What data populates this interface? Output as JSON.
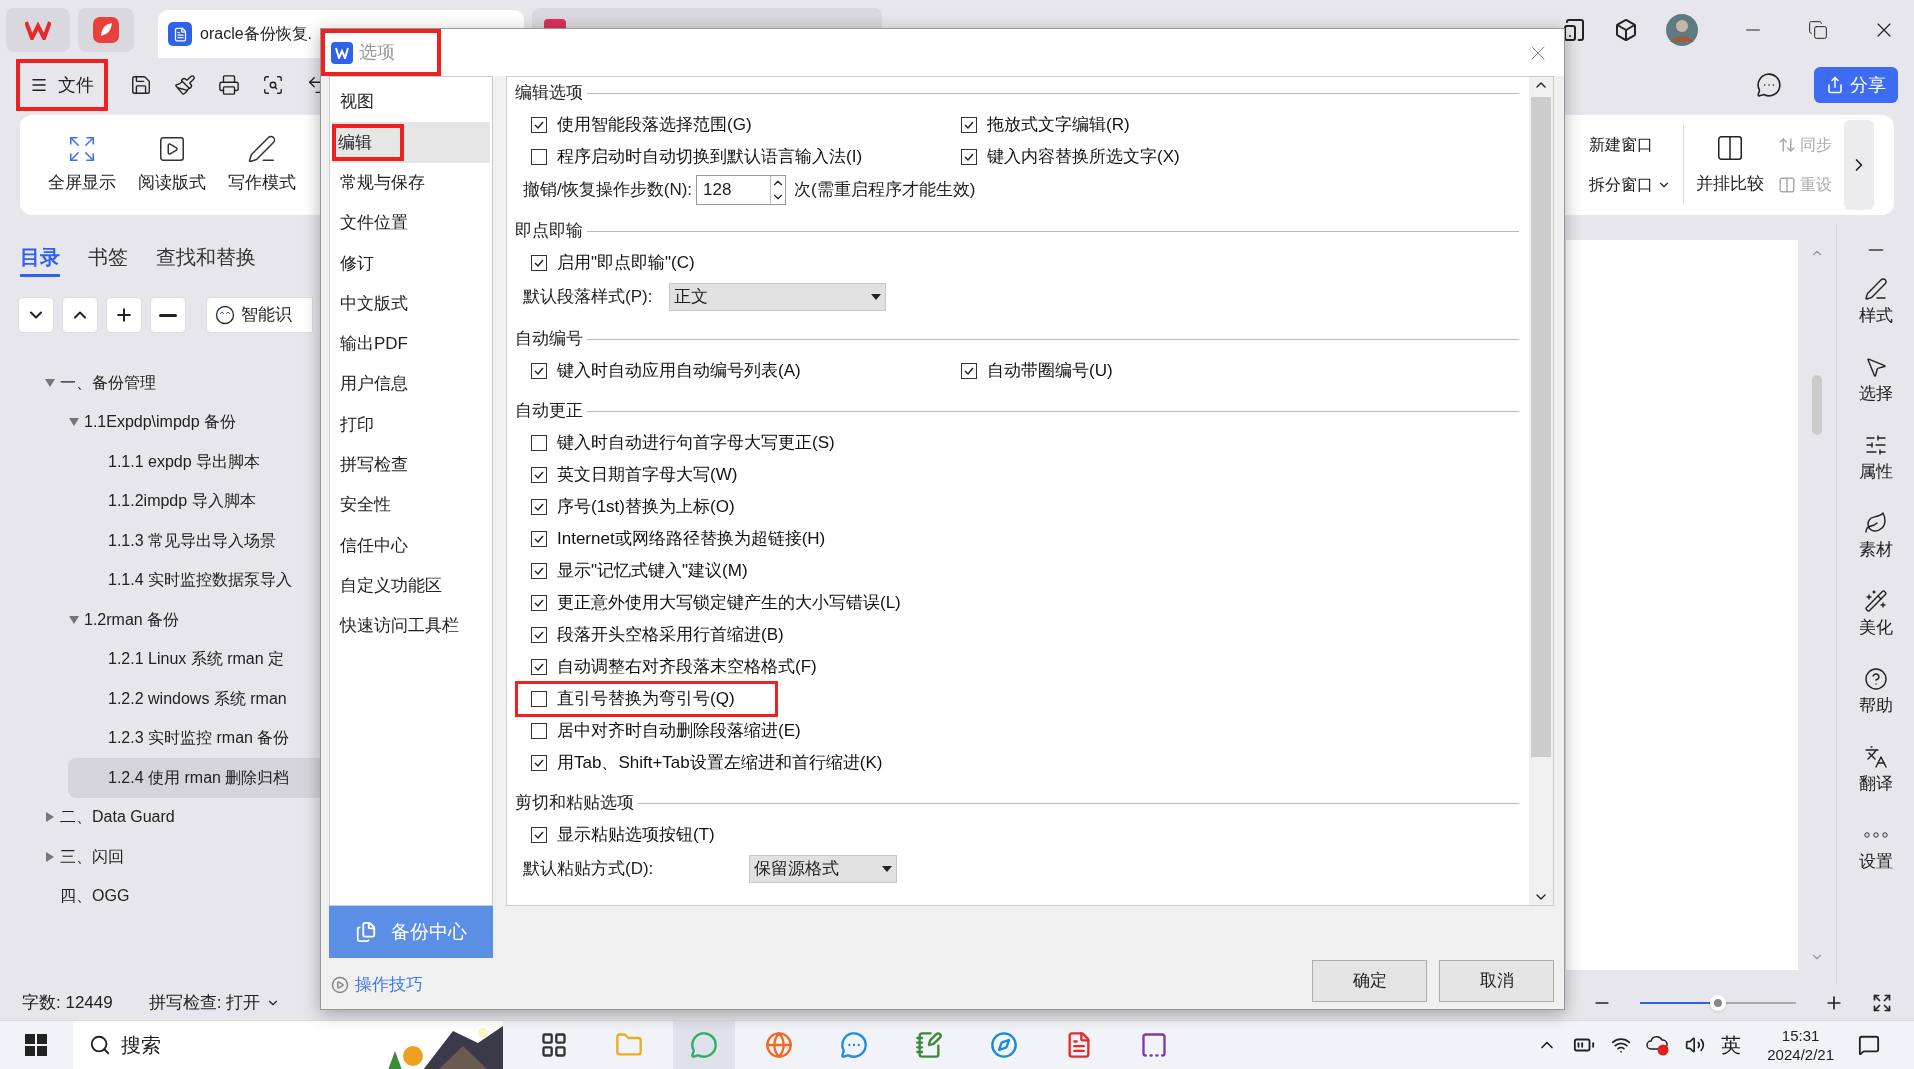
{
  "doc_tab": {
    "title": "oracle备份恢复."
  },
  "toolbar": {
    "file_button": {
      "label": "文件",
      "annotated": true
    },
    "share": "分享"
  },
  "ribbon": {
    "left": [
      "全屏显示",
      "阅读版式",
      "写作模式"
    ],
    "window_items": [
      "新建窗口",
      "拆分窗口"
    ],
    "compare": "并排比较",
    "sync_items": [
      {
        "label": "同步",
        "disabled": true
      },
      {
        "label": "重设",
        "disabled": true
      }
    ]
  },
  "nav_panel": {
    "tabs": [
      {
        "label": "目录",
        "selected": true
      },
      {
        "label": "书签",
        "selected": false
      },
      {
        "label": "查找和替换",
        "selected": false
      }
    ],
    "smart_button": "智能识",
    "tree": [
      {
        "label": "一、备份管理",
        "expanded": true,
        "selected": false,
        "children": [
          {
            "label": "1.1Expdp\\impdp 备份",
            "expanded": true,
            "selected": false,
            "children": [
              {
                "label": "1.1.1 expdp 导出脚本",
                "selected": false
              },
              {
                "label": "1.1.2impdp 导入脚本",
                "selected": false
              },
              {
                "label": "1.1.3 常见导出导入场景",
                "selected": false
              },
              {
                "label": "1.1.4 实时监控数据泵导入",
                "selected": false
              }
            ]
          },
          {
            "label": "1.2rman 备份",
            "expanded": true,
            "selected": false,
            "children": [
              {
                "label": "1.2.1 Linux 系统 rman 定",
                "selected": false
              },
              {
                "label": "1.2.2 windows 系统 rman",
                "selected": false
              },
              {
                "label": "1.2.3 实时监控 rman 备份",
                "selected": false
              },
              {
                "label": "1.2.4  使用 rman 删除归档",
                "selected": true
              }
            ]
          }
        ]
      },
      {
        "label": "二、Data Guard",
        "expanded": false,
        "selected": false
      },
      {
        "label": "三、闪回",
        "expanded": false,
        "selected": false
      },
      {
        "label": "四、OGG",
        "selected": false
      }
    ]
  },
  "dialog": {
    "title": "选项",
    "title_annotated": true,
    "nav": [
      {
        "label": "视图",
        "selected": false,
        "annotated": false
      },
      {
        "label": "编辑",
        "selected": true,
        "annotated": true
      },
      {
        "label": "常规与保存",
        "selected": false,
        "annotated": false
      },
      {
        "label": "文件位置",
        "selected": false,
        "annotated": false
      },
      {
        "label": "修订",
        "selected": false,
        "annotated": false
      },
      {
        "label": "中文版式",
        "selected": false,
        "annotated": false
      },
      {
        "label": "输出PDF",
        "selected": false,
        "annotated": false
      },
      {
        "label": "用户信息",
        "selected": false,
        "annotated": false
      },
      {
        "label": "打印",
        "selected": false,
        "annotated": false
      },
      {
        "label": "拼写检查",
        "selected": false,
        "annotated": false
      },
      {
        "label": "安全性",
        "selected": false,
        "annotated": false
      },
      {
        "label": "信任中心",
        "selected": false,
        "annotated": false
      },
      {
        "label": "自定义功能区",
        "selected": false,
        "annotated": false
      },
      {
        "label": "快速访问工具栏",
        "selected": false,
        "annotated": false
      }
    ],
    "backup_button": "备份中心",
    "tips_link": "操作技巧",
    "sections": [
      {
        "title": "编辑选项",
        "rows": [
          {
            "kind": "pair",
            "items": [
              {
                "label": "使用智能段落选择范围(G)",
                "checked": true,
                "annotated": false
              },
              {
                "label": "拖放式文字编辑(R)",
                "checked": true,
                "annotated": false
              }
            ]
          },
          {
            "kind": "pair",
            "items": [
              {
                "label": "程序启动时自动切换到默认语言输入法(I)",
                "checked": false,
                "annotated": false
              },
              {
                "label": "键入内容替换所选文字(X)",
                "checked": true,
                "annotated": false
              }
            ]
          },
          {
            "kind": "spin",
            "label": "撤销/恢复操作步数(N):",
            "value": "128",
            "note": "次(需重启程序才能生效)"
          }
        ]
      },
      {
        "title": "即点即输",
        "rows": [
          {
            "kind": "check",
            "label": "启用\"即点即输\"(C)",
            "checked": true,
            "annotated": false
          },
          {
            "kind": "select",
            "label": "默认段落样式(P):",
            "value": "正文"
          }
        ]
      },
      {
        "title": "自动编号",
        "rows": [
          {
            "kind": "pair",
            "items": [
              {
                "label": "键入时自动应用自动编号列表(A)",
                "checked": true,
                "annotated": false
              },
              {
                "label": "自动带圈编号(U)",
                "checked": true,
                "annotated": false
              }
            ]
          }
        ]
      },
      {
        "title": "自动更正",
        "rows": [
          {
            "kind": "check",
            "label": "键入时自动进行句首字母大写更正(S)",
            "checked": false,
            "annotated": false
          },
          {
            "kind": "check",
            "label": "英文日期首字母大写(W)",
            "checked": true,
            "annotated": false
          },
          {
            "kind": "check",
            "label": "序号(1st)替换为上标(O)",
            "checked": true,
            "annotated": false
          },
          {
            "kind": "check",
            "label": "Internet或网络路径替换为超链接(H)",
            "checked": true,
            "annotated": false
          },
          {
            "kind": "check",
            "label": "显示\"记忆式键入\"建议(M)",
            "checked": true,
            "annotated": false
          },
          {
            "kind": "check",
            "label": "更正意外使用大写锁定键产生的大小写错误(L)",
            "checked": true,
            "annotated": false
          },
          {
            "kind": "check",
            "label": "段落开头空格采用行首缩进(B)",
            "checked": true,
            "annotated": false
          },
          {
            "kind": "check",
            "label": "自动调整右对齐段落末空格格式(F)",
            "checked": true,
            "annotated": false
          },
          {
            "kind": "check",
            "label": "直引号替换为弯引号(Q)",
            "checked": false,
            "annotated": true
          },
          {
            "kind": "check",
            "label": "居中对齐时自动删除段落缩进(E)",
            "checked": false,
            "annotated": false
          },
          {
            "kind": "check",
            "label": "用Tab、Shift+Tab设置左缩进和首行缩进(K)",
            "checked": true,
            "annotated": false
          }
        ]
      },
      {
        "title": "剪切和粘贴选项",
        "rows": [
          {
            "kind": "check",
            "label": "显示粘贴选项按钮(T)",
            "checked": true,
            "annotated": false
          },
          {
            "kind": "select",
            "label": "默认粘贴方式(D):",
            "value": "保留源格式"
          }
        ]
      }
    ],
    "buttons": [
      "确定",
      "取消"
    ]
  },
  "side_tools": [
    "样式",
    "选择",
    "属性",
    "素材",
    "美化",
    "帮助",
    "翻译",
    "设置"
  ],
  "status_bar": {
    "word_count": "字数: 12449",
    "spell_check": "拼写检查: 打开",
    "zoom": {
      "level": 0.5
    }
  },
  "taskbar": {
    "search": "搜索",
    "apps": [
      {
        "selected": false
      },
      {
        "selected": false
      },
      {
        "selected": true
      },
      {
        "selected": false
      },
      {
        "selected": false
      },
      {
        "selected": false
      },
      {
        "selected": false
      },
      {
        "selected": false
      },
      {
        "selected": false
      }
    ],
    "language": "英",
    "time": "15:31",
    "date": "2024/2/21"
  }
}
